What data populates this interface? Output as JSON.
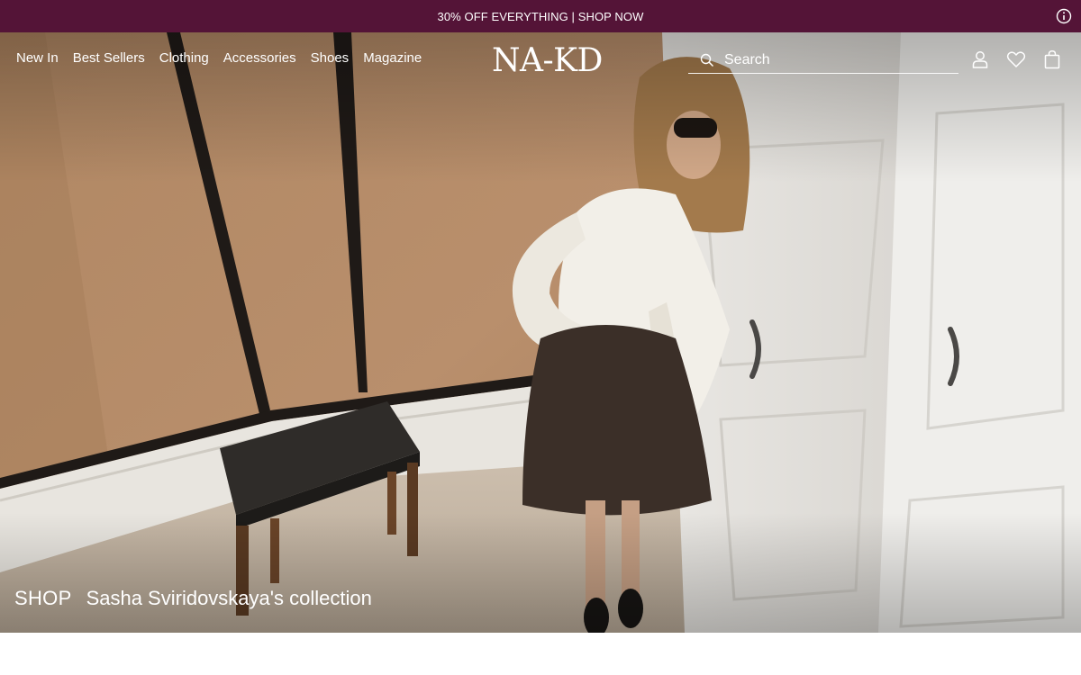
{
  "promo": {
    "text": "30% OFF EVERYTHING | SHOP NOW",
    "bg_color": "#541437",
    "info_icon": "info-icon"
  },
  "header": {
    "nav": [
      {
        "label": "New In"
      },
      {
        "label": "Best Sellers"
      },
      {
        "label": "Clothing"
      },
      {
        "label": "Accessories"
      },
      {
        "label": "Shoes"
      },
      {
        "label": "Magazine"
      }
    ],
    "logo": "NA-KD",
    "search": {
      "placeholder": "Search",
      "value": "",
      "icon": "search-icon"
    },
    "icons": [
      "user-icon",
      "heart-icon",
      "bag-icon"
    ]
  },
  "hero": {
    "shop_label": "SHOP",
    "title": "Sasha Sviridovskaya's collection"
  }
}
